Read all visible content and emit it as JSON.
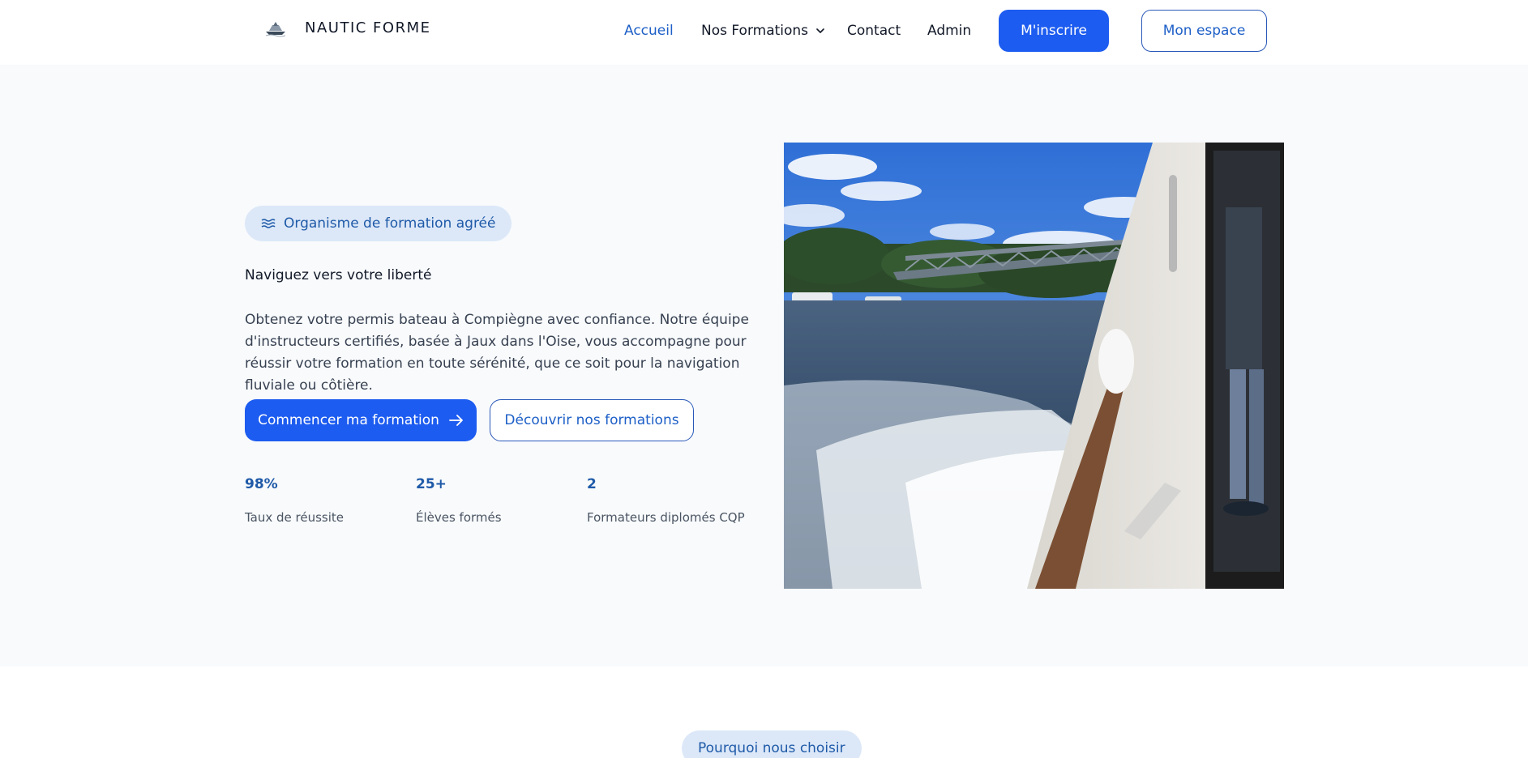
{
  "header": {
    "brand_name": "NAUTIC FORME",
    "brand_icon": "boat-logo-icon",
    "nav": {
      "accueil": "Accueil",
      "formations": "Nos Formations",
      "contact": "Contact",
      "admin": "Admin"
    },
    "inscrire_label": "M'inscrire",
    "espace_label": "Mon espace"
  },
  "hero": {
    "badge": "Organisme de formation agréé",
    "badge_icon": "waves-icon",
    "tagline": "Naviguez vers votre liberté",
    "description": "Obtenez votre permis bateau à Compiègne avec confiance. Notre équipe d'instructeurs certifiés, basée à Jaux dans l'Oise, vous accompagne pour réussir votre formation en toute sérénité, que ce soit pour la navigation fluviale ou côtière.",
    "primary_button": "Commencer ma formation",
    "secondary_button": "Découvrir nos formations",
    "stats": [
      {
        "value": "98%",
        "label": "Taux de réussite"
      },
      {
        "value": "25+",
        "label": "Élèves formés"
      },
      {
        "value": "2",
        "label": "Formateurs diplomés CQP"
      }
    ]
  },
  "next_section": {
    "badge": "Pourquoi nous choisir"
  },
  "colors": {
    "primary": "#1d5cf0",
    "accent_text": "#1f5aa8",
    "hero_bg": "#f8fafc",
    "badge_bg": "#dce8f8"
  }
}
